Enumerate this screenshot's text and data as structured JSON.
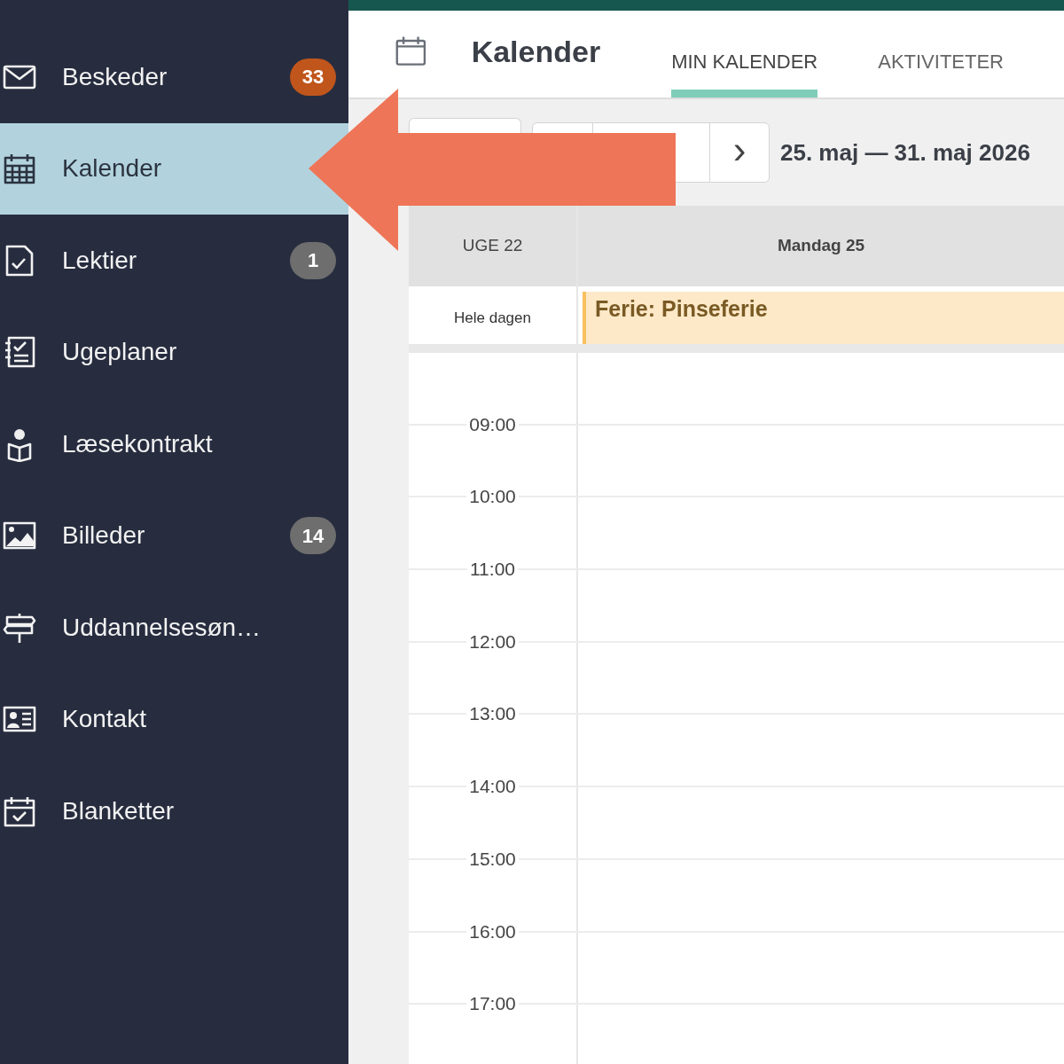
{
  "sidebar": {
    "items": [
      {
        "label": "Beskeder",
        "selected": false,
        "badge": {
          "text": "33",
          "color": "#c0561c"
        }
      },
      {
        "label": "Kalender",
        "selected": true
      },
      {
        "label": "Lektier",
        "selected": false,
        "badge": {
          "text": "1",
          "color": "#6e6e6e"
        }
      },
      {
        "label": "Ugeplaner",
        "selected": false
      },
      {
        "label": "Læsekontrakt",
        "selected": false
      },
      {
        "label": "Billeder",
        "selected": false,
        "badge": {
          "text": "14",
          "color": "#6e6e6e"
        }
      },
      {
        "label": "Uddannelsesøn…",
        "selected": false
      },
      {
        "label": "Kontakt",
        "selected": false
      },
      {
        "label": "Blanketter",
        "selected": false
      }
    ]
  },
  "header": {
    "title": "Kalender",
    "tabs": [
      {
        "label": "MIN KALENDER",
        "selected": true
      },
      {
        "label": "AKTIVITETER",
        "selected": false
      }
    ]
  },
  "toolbar": {
    "date_range": "25. maj — 31. maj 2026",
    "next": "›"
  },
  "calendar": {
    "week_label": "UGE 22",
    "day_header": "Mandag 25",
    "all_day_label": "Hele dagen",
    "all_day_events": [
      {
        "title": "Ferie: Pinseferie"
      }
    ],
    "hours": [
      "09:00",
      "10:00",
      "11:00",
      "12:00",
      "13:00",
      "14:00",
      "15:00",
      "16:00",
      "17:00"
    ]
  }
}
